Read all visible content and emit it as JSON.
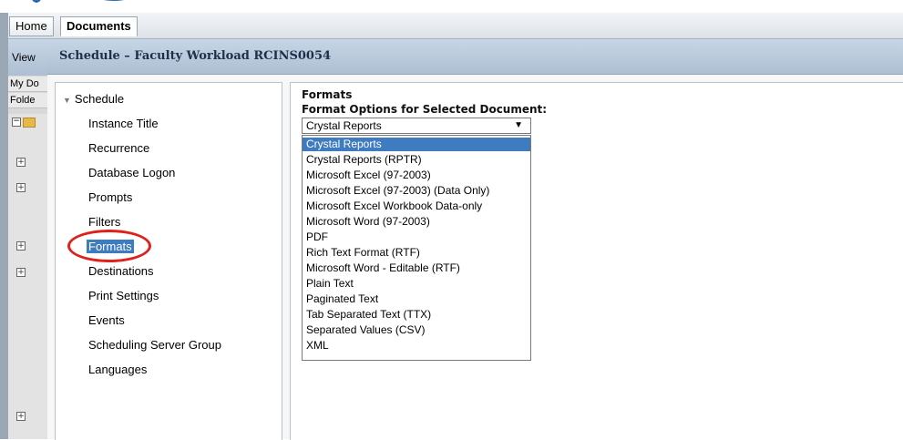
{
  "tabs": {
    "home": "Home",
    "documents": "Documents"
  },
  "left_panel": {
    "view": "View",
    "my_documents": "My Do",
    "folders": "Folde"
  },
  "header": {
    "title": "Schedule – Faculty Workload RCINS0054"
  },
  "nav": {
    "root": "Schedule",
    "items": [
      "Instance Title",
      "Recurrence",
      "Database Logon",
      "Prompts",
      "Filters",
      "Formats",
      "Destinations",
      "Print Settings",
      "Events",
      "Scheduling Server Group",
      "Languages"
    ],
    "selected_index": 5
  },
  "formats": {
    "title": "Formats",
    "subtitle": "Format Options for Selected Document:",
    "selected_value": "Crystal Reports",
    "options": [
      "Crystal Reports",
      "Crystal Reports (RPTR)",
      "Microsoft Excel (97-2003)",
      "Microsoft Excel (97-2003) (Data Only)",
      "Microsoft Excel Workbook Data-only",
      "Microsoft Word (97-2003)",
      "PDF",
      "Rich Text Format (RTF)",
      "Microsoft Word - Editable (RTF)",
      "Plain Text",
      "Paginated Text",
      "Tab Separated Text (TTX)",
      "Separated Values (CSV)",
      "XML"
    ],
    "highlighted_index": 0
  },
  "colors": {
    "header_bg": "#c6d6e6",
    "selection": "#3f7bbf",
    "annotation_circle": "#e0201a"
  }
}
